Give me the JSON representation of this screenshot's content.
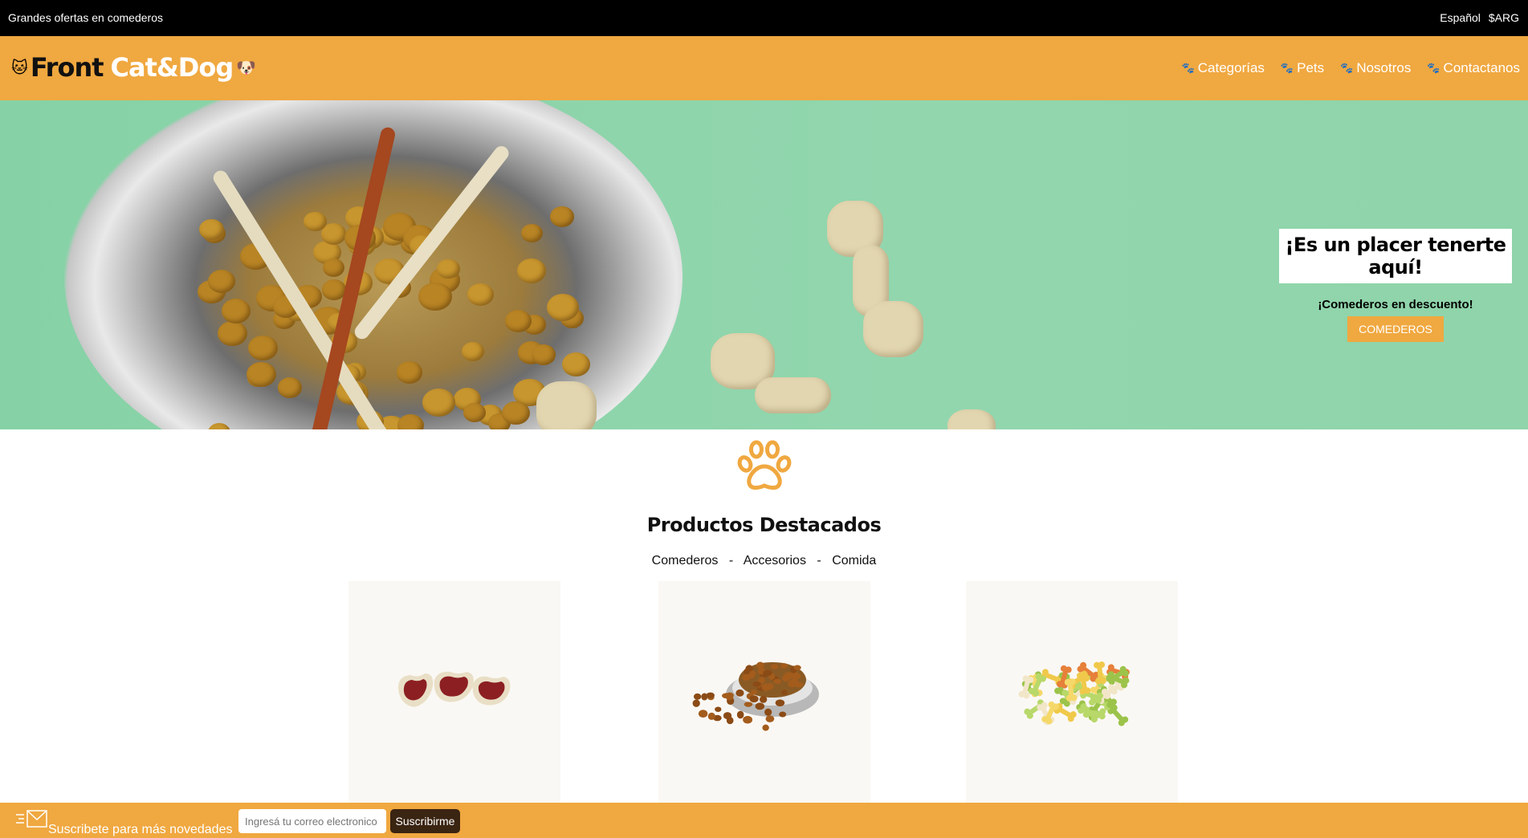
{
  "topbar": {
    "promo": "Grandes ofertas en comederos",
    "language": "Español",
    "currency": "$ARG"
  },
  "brand": {
    "word1": "Front",
    "word2": "Cat&Dog",
    "cat_emoji": "🐱",
    "dog_emoji": "🐶",
    "accent": "#f0a840"
  },
  "nav": {
    "items": [
      {
        "label": "Categorías",
        "icon": "paw-icon"
      },
      {
        "label": "Pets",
        "icon": "paw-icon"
      },
      {
        "label": "Nosotros",
        "icon": "paw-icon"
      },
      {
        "label": "Contactanos",
        "icon": "paw-icon"
      }
    ]
  },
  "hero": {
    "title": "¡Es un placer tenerte aquí!",
    "subtitle": "¡Comederos en descuento!",
    "button": "COMEDEROS"
  },
  "featured": {
    "title": "Productos Destacados",
    "filters": [
      "Comederos",
      "Accesorios",
      "Comida"
    ],
    "separator": "-"
  },
  "products": [
    {
      "image": "meat-snack-image"
    },
    {
      "image": "kibble-bowl-image"
    },
    {
      "image": "bone-cookies-image"
    }
  ],
  "subscribe": {
    "text": "Suscribete para más novedades",
    "placeholder": "Ingresá tu correo electronico",
    "button": "Suscribirme",
    "button_color": "#3a2412"
  }
}
